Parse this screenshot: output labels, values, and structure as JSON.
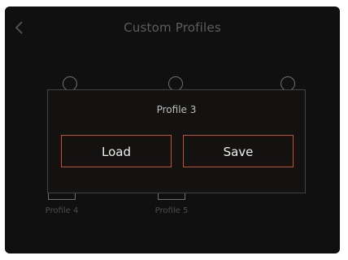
{
  "header": {
    "title": "Custom Profiles"
  },
  "icons": {
    "back": "chevron-left-icon"
  },
  "profile_slots": [
    {
      "label": "Profile 4",
      "number": "4"
    },
    {
      "label": "Profile 5",
      "number": "5"
    }
  ],
  "dialog": {
    "title": "Profile 3",
    "load_label": "Load",
    "save_label": "Save"
  },
  "colors": {
    "background": "#111010",
    "accent": "#c7502c"
  }
}
